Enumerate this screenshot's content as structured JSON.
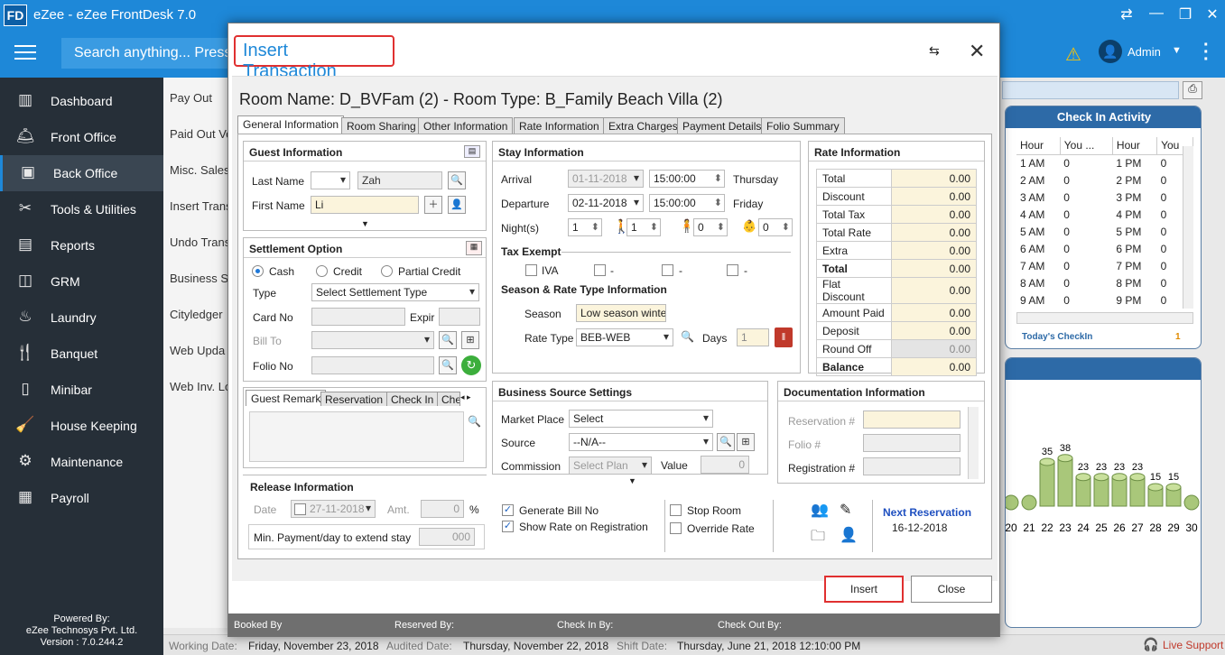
{
  "app": {
    "icon_text": "FD",
    "title": "eZee - eZee FrontDesk 7.0"
  },
  "header": {
    "search_placeholder": "Search anything... Press",
    "user": "Admin"
  },
  "sidebar": {
    "items": [
      {
        "label": "Dashboard",
        "icon": "dashboard-icon"
      },
      {
        "label": "Front Office",
        "icon": "front-office-icon"
      },
      {
        "label": "Back Office",
        "icon": "back-office-icon",
        "active": true
      },
      {
        "label": "Tools & Utilities",
        "icon": "tools-icon"
      },
      {
        "label": "Reports",
        "icon": "reports-icon"
      },
      {
        "label": "GRM",
        "icon": "grm-icon"
      },
      {
        "label": "Laundry",
        "icon": "laundry-icon"
      },
      {
        "label": "Banquet",
        "icon": "banquet-icon"
      },
      {
        "label": "Minibar",
        "icon": "minibar-icon"
      },
      {
        "label": "House Keeping",
        "icon": "housekeeping-icon"
      },
      {
        "label": "Maintenance",
        "icon": "maintenance-icon"
      },
      {
        "label": "Payroll",
        "icon": "payroll-icon"
      }
    ],
    "powered_by": "Powered By:",
    "company": "eZee Technosys Pvt. Ltd.",
    "version": "Version : 7.0.244.2"
  },
  "submenu": [
    "Pay Out",
    "Paid Out Vo",
    "Misc. Sales",
    "Insert Trans",
    "Undo Trans",
    "Business So",
    "Cityledger",
    "Web Upda",
    "Web Inv. Lo"
  ],
  "checkin_activity": {
    "title": "Check In Activity",
    "headers": [
      "Hour",
      "You ...",
      "Hour",
      "You"
    ],
    "rows": [
      [
        "1 AM",
        "0",
        "1 PM",
        "0"
      ],
      [
        "2 AM",
        "0",
        "2 PM",
        "0"
      ],
      [
        "3 AM",
        "0",
        "3 PM",
        "0"
      ],
      [
        "4 AM",
        "0",
        "4 PM",
        "0"
      ],
      [
        "5 AM",
        "0",
        "5 PM",
        "0"
      ],
      [
        "6 AM",
        "0",
        "6 PM",
        "0"
      ],
      [
        "7 AM",
        "0",
        "7 PM",
        "0"
      ],
      [
        "8 AM",
        "0",
        "8 PM",
        "0"
      ],
      [
        "9 AM",
        "0",
        "9 PM",
        "0"
      ]
    ],
    "today_label": "Today's CheckIn",
    "today_value": "1"
  },
  "chart_data": {
    "type": "bar",
    "categories": [
      "20",
      "21",
      "22",
      "23",
      "24",
      "25",
      "26",
      "27",
      "28",
      "29",
      "30"
    ],
    "values": [
      null,
      null,
      35,
      38,
      23,
      23,
      23,
      23,
      15,
      15,
      null
    ]
  },
  "status": {
    "working_label": "Working Date:",
    "working": "Friday, November 23, 2018",
    "audited_label": "Audited Date:",
    "audited": "Thursday, November 22, 2018",
    "shift_label": "Shift Date:",
    "shift": "Thursday, June 21, 2018 12:10:00 PM",
    "live_support": "Live Support"
  },
  "modal": {
    "title": "Insert Transaction",
    "room": "Room Name: D_BVFam (2) - Room Type: B_Family Beach Villa (2)",
    "tabs": [
      "General Information",
      "Room Sharing",
      "Other Information",
      "Rate Information",
      "Extra Charges",
      "Payment Details",
      "Folio Summary"
    ],
    "guest": {
      "title": "Guest Information",
      "last_name_label": "Last Name",
      "last_name": "Zah",
      "first_name_label": "First Name",
      "first_name": "Li"
    },
    "settlement": {
      "title": "Settlement Option",
      "cash": "Cash",
      "credit": "Credit",
      "partial": "Partial Credit",
      "type_label": "Type",
      "type_value": "Select Settlement Type",
      "card_label": "Card No",
      "expiry_label": "Expir",
      "bill_label": "Bill To",
      "folio_label": "Folio No"
    },
    "remark_tabs": [
      "Guest Remark",
      "Reservation",
      "Check In",
      "Che"
    ],
    "release": {
      "title": "Release Information",
      "date_label": "Date",
      "date": "27-11-2018",
      "amt_label": "Amt.",
      "amt": "0",
      "pct": "%",
      "min_label": "Min. Payment/day to extend stay",
      "min": "000"
    },
    "stay": {
      "title": "Stay Information",
      "arrival_label": "Arrival",
      "arrival_date": "01-11-2018",
      "arrival_time": "15:00:00",
      "arrival_day": "Thursday",
      "departure_label": "Departure",
      "departure_date": "02-11-2018",
      "departure_time": "15:00:00",
      "departure_day": "Friday",
      "nights_label": "Night(s)",
      "nights": "1",
      "adults": "1",
      "children": "0",
      "infants": "0",
      "tax_title": "Tax Exempt",
      "tax_items": [
        "IVA",
        "-",
        "-",
        "-"
      ],
      "season_title": "Season & Rate Type Information",
      "season_label": "Season",
      "season": "Low season winter",
      "rate_type_label": "Rate Type",
      "rate_type": "BEB-WEB",
      "days_label": "Days",
      "days": "1"
    },
    "rate": {
      "title": "Rate Information",
      "rows": [
        {
          "k": "Total",
          "v": "0.00"
        },
        {
          "k": "Discount",
          "v": "0.00"
        },
        {
          "k": "Total Tax",
          "v": "0.00"
        },
        {
          "k": "Total Rate",
          "v": "0.00"
        },
        {
          "k": "Extra",
          "v": "0.00"
        },
        {
          "k": "Total",
          "v": "0.00",
          "bold": true
        },
        {
          "k": "Flat Discount",
          "v": "0.00"
        },
        {
          "k": "Amount Paid",
          "v": "0.00"
        },
        {
          "k": "Deposit",
          "v": "0.00"
        },
        {
          "k": "Round Off",
          "v": "0.00",
          "grey": true
        },
        {
          "k": "Balance",
          "v": "0.00",
          "bold": true
        }
      ]
    },
    "business": {
      "title": "Business Source Settings",
      "market_label": "Market Place",
      "market": "Select",
      "source_label": "Source",
      "source": "--N/A--",
      "commission_label": "Commission",
      "commission": "Select Plan",
      "value_label": "Value",
      "value": "0"
    },
    "doc": {
      "title": "Documentation Information",
      "res_label": "Reservation #",
      "folio_label": "Folio #",
      "reg_label": "Registration #"
    },
    "options": {
      "generate": "Generate Bill No",
      "show_rate": "Show Rate on Registration",
      "stop_room": "Stop Room",
      "override": "Override Rate"
    },
    "next_res": {
      "label": "Next Reservation",
      "date": "16-12-2018"
    },
    "insert": "Insert",
    "close": "Close",
    "footer": {
      "booked": "Booked By",
      "reserved": "Reserved By:",
      "checkin": "Check In By:",
      "checkout": "Check Out By:"
    }
  }
}
